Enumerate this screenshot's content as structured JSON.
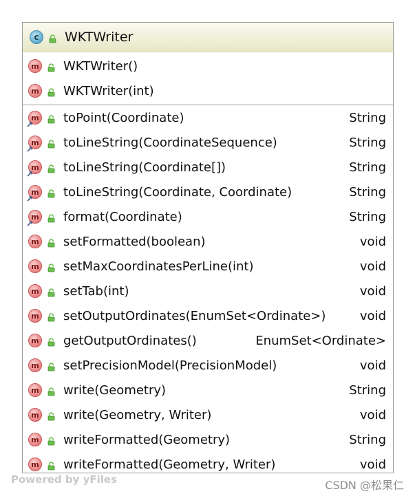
{
  "class": {
    "badge": "c",
    "name": "WKTWriter"
  },
  "constructors": [
    {
      "badge": "m",
      "signature": "WKTWriter()"
    },
    {
      "badge": "m",
      "signature": "WKTWriter(int)"
    }
  ],
  "methods": [
    {
      "badge": "m",
      "signature": "toPoint(Coordinate)",
      "return_type": "String",
      "override": true
    },
    {
      "badge": "m",
      "signature": "toLineString(CoordinateSequence)",
      "return_type": "String",
      "override": true
    },
    {
      "badge": "m",
      "signature": "toLineString(Coordinate[])",
      "return_type": "String",
      "override": true
    },
    {
      "badge": "m",
      "signature": "toLineString(Coordinate, Coordinate)",
      "return_type": "String",
      "override": true
    },
    {
      "badge": "m",
      "signature": "format(Coordinate)",
      "return_type": "String",
      "override": true
    },
    {
      "badge": "m",
      "signature": "setFormatted(boolean)",
      "return_type": "void",
      "override": false
    },
    {
      "badge": "m",
      "signature": "setMaxCoordinatesPerLine(int)",
      "return_type": "void",
      "override": false
    },
    {
      "badge": "m",
      "signature": "setTab(int)",
      "return_type": "void",
      "override": false
    },
    {
      "badge": "m",
      "signature": "setOutputOrdinates(EnumSet<Ordinate>)",
      "return_type": "void",
      "override": false
    },
    {
      "badge": "m",
      "signature": "getOutputOrdinates()",
      "return_type": "EnumSet<Ordinate>",
      "override": false
    },
    {
      "badge": "m",
      "signature": "setPrecisionModel(PrecisionModel)",
      "return_type": "void",
      "override": false
    },
    {
      "badge": "m",
      "signature": "write(Geometry)",
      "return_type": "String",
      "override": false
    },
    {
      "badge": "m",
      "signature": "write(Geometry, Writer)",
      "return_type": "void",
      "override": false
    },
    {
      "badge": "m",
      "signature": "writeFormatted(Geometry)",
      "return_type": "String",
      "override": false
    },
    {
      "badge": "m",
      "signature": "writeFormatted(Geometry, Writer)",
      "return_type": "void",
      "override": false
    }
  ],
  "watermark": {
    "left": "Powered by yFiles",
    "right": "CSDN @松果仁"
  },
  "colors": {
    "header_bg": "#f0f0da",
    "class_badge": "#6fb7d6",
    "method_badge": "#ee8f8f",
    "lock_icon": "#6cbf4f",
    "border": "#9d9d9d"
  },
  "icons": {
    "class_badge": "class-icon",
    "method_badge": "method-icon",
    "visibility": "public-lock-icon",
    "override": "override-arrow-icon"
  }
}
